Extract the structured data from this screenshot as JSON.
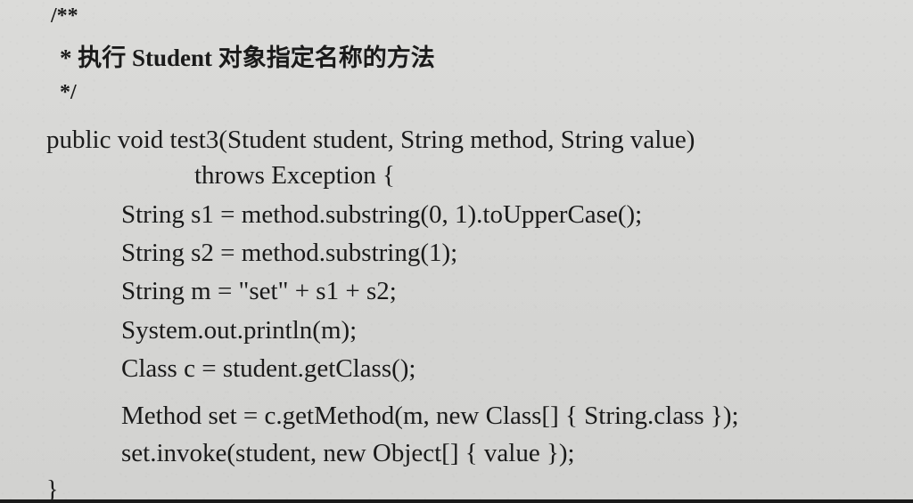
{
  "document": {
    "lines": {
      "comment_open": "/**",
      "comment_text": "* 执行 Student 对象指定名称的方法",
      "comment_close": "*/",
      "method_signature": "public void test3(Student student, String method, String value)",
      "throws_clause": "throws Exception {",
      "line_s1": "String s1 = method.substring(0, 1).toUpperCase();",
      "line_s2": "String s2 = method.substring(1);",
      "line_m": "String m = \"set\" + s1 + s2;",
      "line_print": "System.out.println(m);",
      "line_class": "Class c = student.getClass();",
      "line_method": "Method set = c.getMethod(m, new Class[] { String.class });",
      "line_invoke": "set.invoke(student, new Object[] { value });",
      "closing_brace": "}"
    }
  }
}
